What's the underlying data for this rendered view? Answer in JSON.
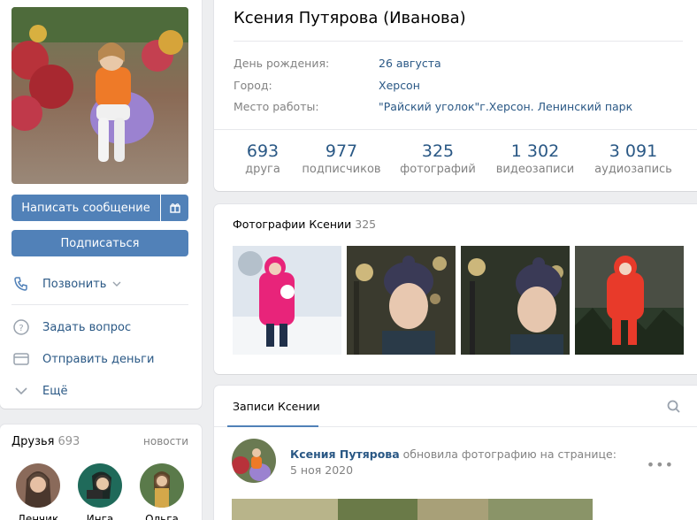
{
  "sidebar": {
    "message_button": "Написать сообщение",
    "subscribe_button": "Подписаться",
    "call": "Позвонить",
    "ask_question": "Задать вопрос",
    "send_money": "Отправить деньги",
    "more": "Ещё"
  },
  "friends": {
    "title": "Друзья",
    "count": "693",
    "news_link": "новости",
    "items": [
      {
        "name": "Ленчик"
      },
      {
        "name": "Инга"
      },
      {
        "name": "Ольга"
      }
    ]
  },
  "profile": {
    "name": "Ксения Путярова (Иванова)",
    "info": [
      {
        "label": "День рождения:",
        "value": "26 августа"
      },
      {
        "label": "Город:",
        "value": "Херсон"
      },
      {
        "label": "Место работы:",
        "value": "\"Райский уголок\"г.Херсон. Ленинский парк"
      }
    ],
    "counters": [
      {
        "num": "693",
        "label": "друга"
      },
      {
        "num": "977",
        "label": "подписчиков"
      },
      {
        "num": "325",
        "label": "фотографий"
      },
      {
        "num": "1 302",
        "label": "видеозаписи"
      },
      {
        "num": "3 091",
        "label": "аудиозапись"
      }
    ]
  },
  "photos": {
    "title": "Фотографии Ксении",
    "count": "325"
  },
  "wall": {
    "tab": "Записи Ксении",
    "post": {
      "author": "Ксения Путярова",
      "action": "обновила фотографию на странице:",
      "date": "5 ноя 2020",
      "more": "•••"
    }
  },
  "colors": {
    "accent": "#5181b8",
    "link": "#2a5885",
    "muted": "#828282",
    "background": "#edeef0"
  }
}
